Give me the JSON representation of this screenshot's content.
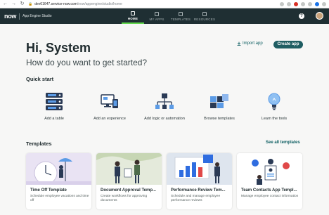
{
  "browser": {
    "url_host": "dev61647.service-now.com",
    "url_path": "/now/appengine/studio/home"
  },
  "header": {
    "logo": "now",
    "app_name": "App Engine Studio",
    "tabs": [
      {
        "label": "HOME",
        "active": true
      },
      {
        "label": "MY APPS",
        "active": false
      },
      {
        "label": "TEMPLATES",
        "active": false
      },
      {
        "label": "RESOURCES",
        "active": false
      }
    ],
    "help_symbol": "?"
  },
  "hero": {
    "title": "Hi, System",
    "subtitle": "How do you want to get started?",
    "import_label": "Import app",
    "create_label": "Create app"
  },
  "quick_start": {
    "title": "Quick start",
    "items": [
      {
        "label": "Add a table",
        "icon": "database-icon"
      },
      {
        "label": "Add an experience",
        "icon": "monitor-icon"
      },
      {
        "label": "Add logic or automation",
        "icon": "flow-icon"
      },
      {
        "label": "Browse templates",
        "icon": "templates-icon"
      },
      {
        "label": "Learn the tools",
        "icon": "lightbulb-icon"
      }
    ]
  },
  "templates": {
    "title": "Templates",
    "see_all": "See all templates",
    "cards": [
      {
        "title": "Time Off Template",
        "desc": "Schedule employee vacations and time off"
      },
      {
        "title": "Document Approval Temp...",
        "desc": "Create workflows for approving documents"
      },
      {
        "title": "Performance Review Tem...",
        "desc": "Schedule and manage employee performance reviews"
      },
      {
        "title": "Team Contacts App Templ...",
        "desc": "Manage employee contact information"
      }
    ]
  },
  "colors": {
    "header_bg": "#1f2f33",
    "accent_green": "#62d84e",
    "primary_button": "#1f5d62",
    "link": "#0d5e62"
  }
}
